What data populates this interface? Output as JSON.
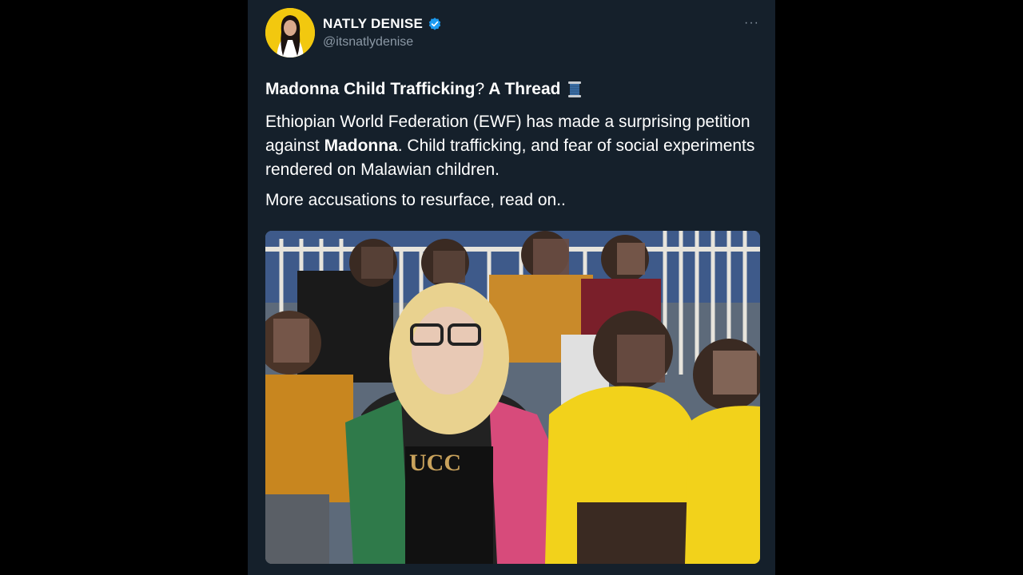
{
  "tweet": {
    "author_name": "NATLY DENISE",
    "author_handle": "@itsnatlydenise",
    "verified": true,
    "more_icon": "more-horizontal-icon",
    "title_bold_1": "Madonna Child Trafficking",
    "title_mid": "?",
    "title_bold_2": " A Thread",
    "title_emoji": "spool-of-thread",
    "body_1": "Ethiopian World Federation (EWF) has made a surprising petition against ",
    "body_bold": "Madonna",
    "body_2": ". Child trafficking, and fear of social experiments rendered on Malawian children.",
    "body_3": "More accusations to resurface, read on..",
    "image": "photo of Madonna with children (faces pixelated)"
  },
  "colors": {
    "background": "#15202b",
    "outer": "#000000",
    "secondary_text": "#8b98a5",
    "verified_blue": "#1d9bf0",
    "avatar_bg": "#f2c80f"
  }
}
